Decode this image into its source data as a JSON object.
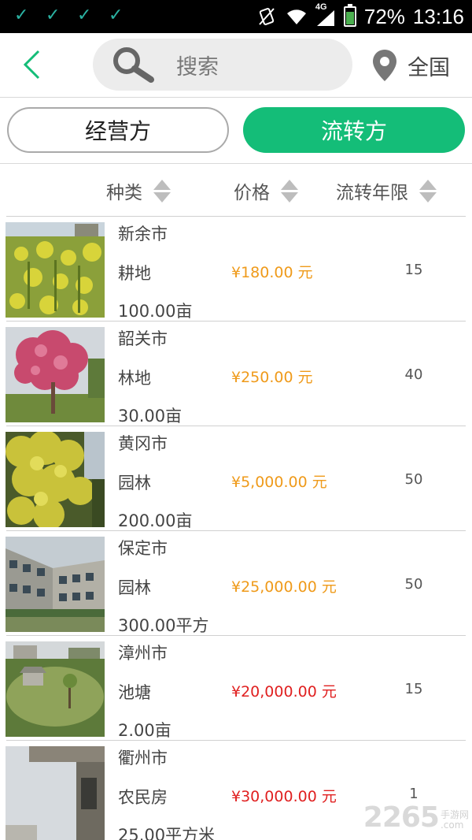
{
  "status_bar": {
    "network": "4G",
    "battery": "72%",
    "battery_level": 0.72,
    "time": "13:16",
    "left_icons": [
      "check-icon",
      "check-icon",
      "check-icon",
      "check-icon"
    ]
  },
  "header": {
    "search_placeholder": "搜索",
    "location": "全国"
  },
  "segments": {
    "left": "经营方",
    "right": "流转方",
    "active": "right"
  },
  "sort_headers": [
    "种类",
    "价格",
    "流转年限"
  ],
  "listings": [
    {
      "city": "新余市",
      "kind": "耕地",
      "price": "¥180.00 元",
      "years": "15",
      "area": "100.00亩",
      "price_color": "#ef9a1a"
    },
    {
      "city": "韶关市",
      "kind": "林地",
      "price": "¥250.00 元",
      "years": "40",
      "area": "30.00亩",
      "price_color": "#ef9a1a"
    },
    {
      "city": "黄冈市",
      "kind": "园林",
      "price": "¥5,000.00 元",
      "years": "50",
      "area": "200.00亩",
      "price_color": "#ef9a1a"
    },
    {
      "city": "保定市",
      "kind": "园林",
      "price": "¥25,000.00 元",
      "years": "50",
      "area": "300.00平方",
      "price_color": "#ef9a1a"
    },
    {
      "city": "漳州市",
      "kind": "池塘",
      "price": "¥20,000.00 元",
      "years": "15",
      "area": "2.00亩",
      "price_color": "#e02020"
    },
    {
      "city": "衢州市",
      "kind": "农民房",
      "price": "¥30,000.00 元",
      "years": "1",
      "area": "25.00平方米",
      "price_color": "#e02020"
    }
  ],
  "watermark": {
    "number": "2265",
    "small_top": "手游网",
    "small_bottom": ".com"
  },
  "colors": {
    "accent": "#14bd78",
    "back_arrow": "#14bd78"
  }
}
